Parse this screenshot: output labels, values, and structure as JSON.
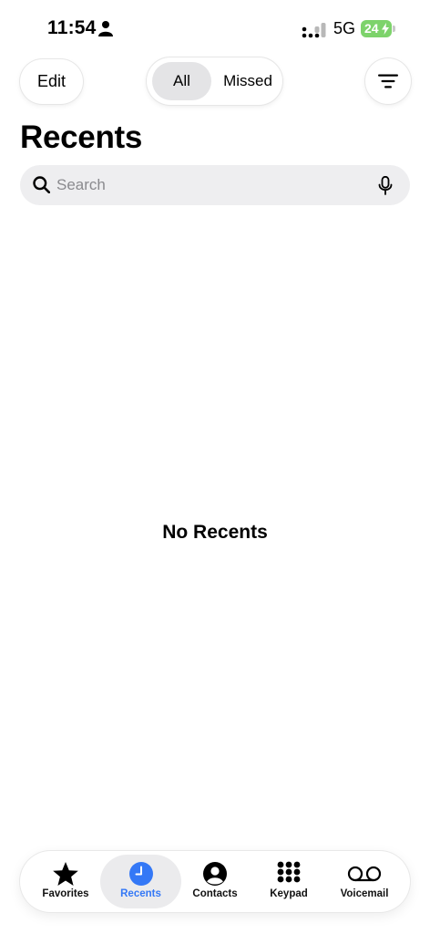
{
  "status_bar": {
    "time": "11:54",
    "network": "5G",
    "battery": "24"
  },
  "top_bar": {
    "edit_label": "Edit",
    "segments": [
      {
        "label": "All",
        "selected": true
      },
      {
        "label": "Missed",
        "selected": false
      }
    ]
  },
  "page": {
    "title": "Recents"
  },
  "search": {
    "placeholder": "Search",
    "value": ""
  },
  "empty_state": {
    "text": "No Recents"
  },
  "tab_bar": {
    "tabs": [
      {
        "label": "Favorites",
        "icon": "star-icon"
      },
      {
        "label": "Recents",
        "icon": "clock-icon",
        "active": true
      },
      {
        "label": "Contacts",
        "icon": "person-circle-icon"
      },
      {
        "label": "Keypad",
        "icon": "keypad-icon"
      },
      {
        "label": "Voicemail",
        "icon": "voicemail-icon"
      }
    ]
  },
  "colors": {
    "accent": "#3478f6",
    "battery": "#7dd36b",
    "search_bg": "#eeeef0",
    "selected_segment_bg": "#e4e4e6"
  }
}
